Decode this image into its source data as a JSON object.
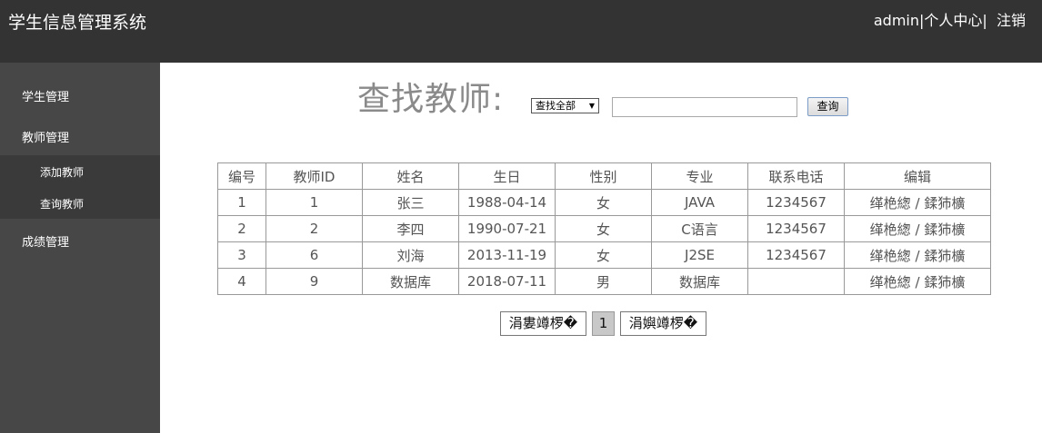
{
  "header": {
    "title": "学生信息管理系统",
    "user": "admin",
    "separator": "|",
    "profile_label": "个人中心",
    "logout_label": "注销"
  },
  "sidebar": {
    "items": [
      {
        "label": "学生管理"
      },
      {
        "label": "教师管理"
      },
      {
        "label": "成绩管理"
      }
    ],
    "submenu": [
      {
        "label": "添加教师"
      },
      {
        "label": "查询教师"
      }
    ]
  },
  "search": {
    "heading": "查找教师:",
    "select_value": "查找全部",
    "input_value": "",
    "button_label": "查询"
  },
  "table": {
    "headers": [
      "编号",
      "教师ID",
      "姓名",
      "生日",
      "性别",
      "专业",
      "联系电话",
      "编辑"
    ],
    "rows": [
      {
        "num": "1",
        "id": "1",
        "name": "张三",
        "birthday": "1988-04-14",
        "gender": "女",
        "major": "JAVA",
        "phone": "1234567"
      },
      {
        "num": "2",
        "id": "2",
        "name": "李四",
        "birthday": "1990-07-21",
        "gender": "女",
        "major": "C语言",
        "phone": "1234567"
      },
      {
        "num": "3",
        "id": "6",
        "name": "刘海",
        "birthday": "2013-11-19",
        "gender": "女",
        "major": "J2SE",
        "phone": "1234567"
      },
      {
        "num": "4",
        "id": "9",
        "name": "数据库",
        "birthday": "2018-07-11",
        "gender": "男",
        "major": "数据库",
        "phone": ""
      }
    ],
    "edit_label": "缂栬緫",
    "edit_separator": "/",
    "delete_label": "鍒犻櫎"
  },
  "pagination": {
    "prev_label": "涓婁竴椤�",
    "current_page": "1",
    "next_label": "涓嬩竴椤�"
  }
}
